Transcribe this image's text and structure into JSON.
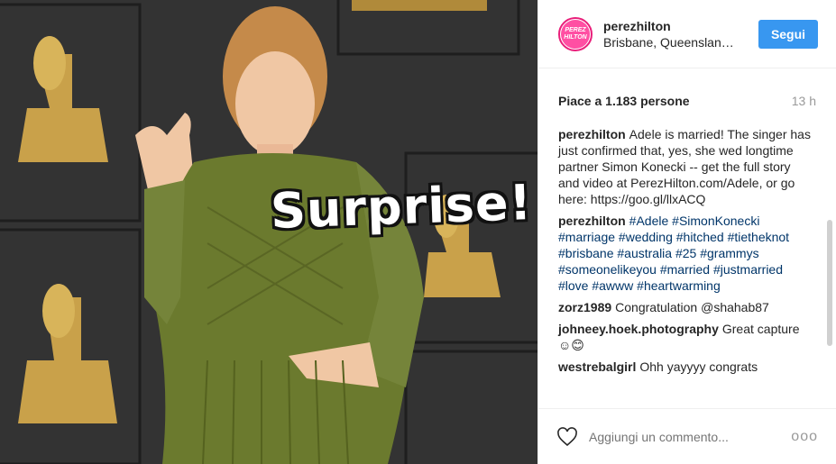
{
  "photo": {
    "overlay_text": "Surprise!",
    "background_color": "#2f2f2f",
    "dress_color": "#6b7a2e"
  },
  "header": {
    "avatar_text_line1": "PEREZ",
    "avatar_text_line2": "HILTON",
    "username": "perezhilton",
    "location": "Brisbane, Queenslan…",
    "follow_label": "Segui"
  },
  "stats": {
    "likes": "Piace a 1.183 persone",
    "time_ago": "13 h"
  },
  "comments": [
    {
      "author": "perezhilton",
      "text": "Adele is married! The singer has just confirmed that, yes, she wed longtime partner Simon Konecki -- get the full story and video at PerezHilton.com/Adele, or go here: https://goo.gl/llxACQ"
    },
    {
      "author": "perezhilton",
      "text": "#Adele #SimonKonecki #marriage #wedding #hitched #tietheknot #brisbane #australia #25 #grammys #someonelikeyou #married #justmarried #love #awww #heartwarming"
    },
    {
      "author": "zorz1989",
      "text": "Congratulation @shahab87"
    },
    {
      "author": "johneey.hoek.photography",
      "text": "Great capture ☺😊"
    },
    {
      "author": "westrebalgirl",
      "text": "Ohh yayyyy congrats"
    }
  ],
  "footer": {
    "comment_placeholder": "Aggiungi un commento...",
    "more_icon": "ooo",
    "heart_icon": "heart-outline-icon"
  },
  "colors": {
    "accent": "#3897f0",
    "link": "#003569",
    "muted": "#999999"
  }
}
